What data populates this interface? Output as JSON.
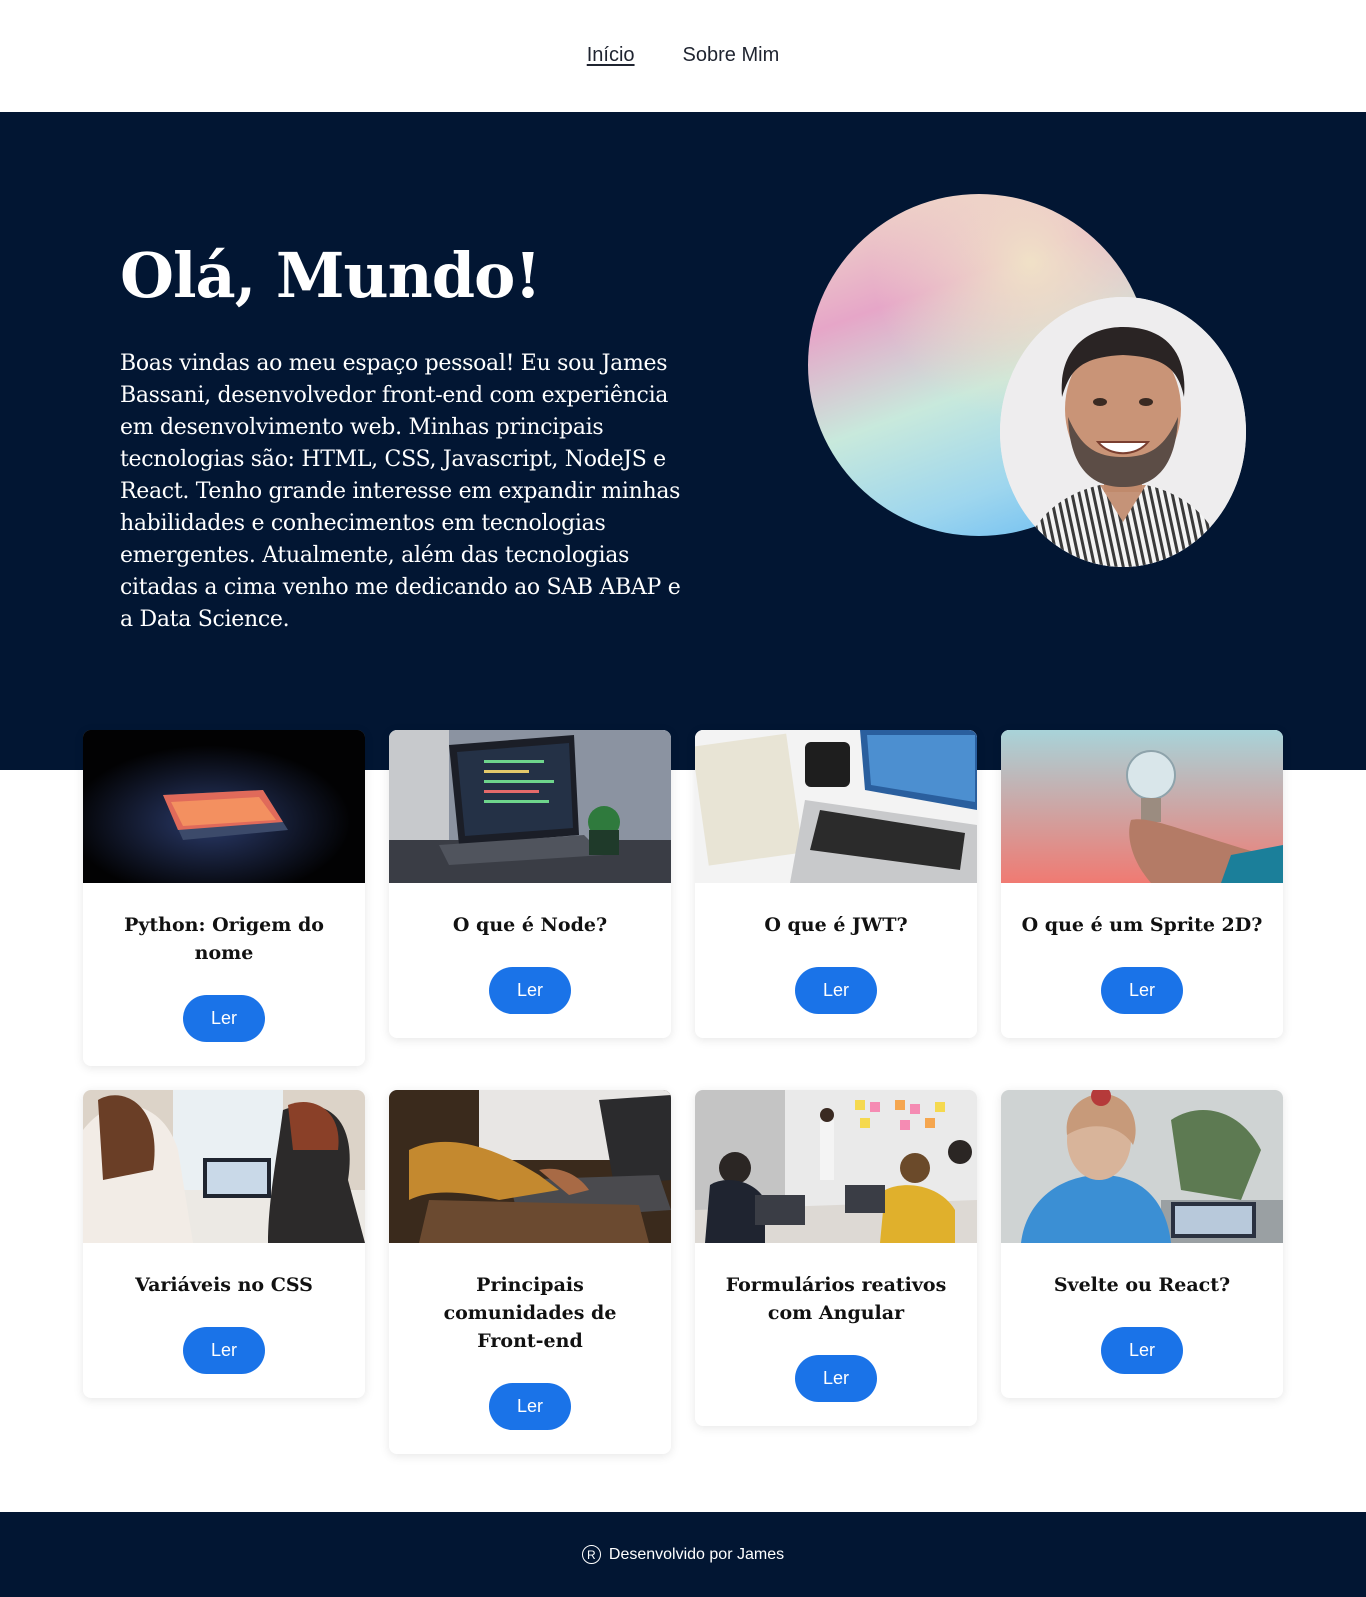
{
  "nav": {
    "items": [
      {
        "label": "Início",
        "active": true
      },
      {
        "label": "Sobre Mim",
        "active": false
      }
    ]
  },
  "hero": {
    "title": "Olá, Mundo!",
    "description": "Boas vindas ao meu espaço pessoal! Eu sou James Bassani, desenvolvedor front-end com experiência em desenvolvimento web. Minhas principais tecnologias são: HTML, CSS, Javascript, NodeJS e React. Tenho grande interesse em expandir minhas habilidades e conhecimentos em tecnologias emergentes. Atualmente, além das tecnologias citadas a cima venho me dedicando ao SAB ABAP e a Data Science."
  },
  "cards": [
    {
      "title": "Python: Origem do nome",
      "button": "Ler"
    },
    {
      "title": "O que é Node?",
      "button": "Ler"
    },
    {
      "title": "O que é JWT?",
      "button": "Ler"
    },
    {
      "title": "O que é um Sprite 2D?",
      "button": "Ler"
    },
    {
      "title": "Variáveis no CSS",
      "button": "Ler"
    },
    {
      "title": "Principais comunidades de Front-end",
      "button": "Ler"
    },
    {
      "title": "Formulários reativos com Angular",
      "button": "Ler"
    },
    {
      "title": "Svelte ou React?",
      "button": "Ler"
    }
  ],
  "footer": {
    "symbol": "R",
    "text": "Desenvolvido por James"
  },
  "colors": {
    "navy": "#021633",
    "button": "#1a73e8"
  }
}
